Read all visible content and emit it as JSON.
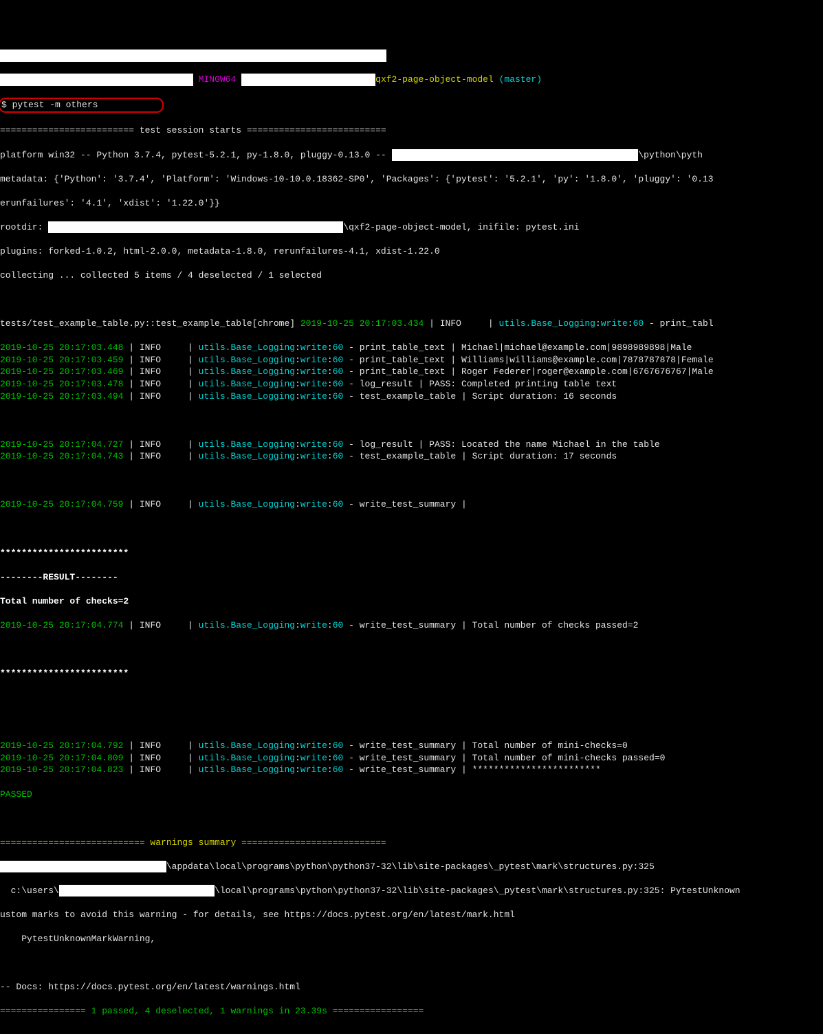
{
  "prompt": {
    "mingw": "MINGW64",
    "repo": "qxf2-page-object-model",
    "branch": "(master)",
    "cmd": "$ pytest -m others"
  },
  "session": {
    "header": "========================= test session starts ==========================",
    "platform": "platform win32 -- Python 3.7.4, pytest-5.2.1, py-1.8.0, pluggy-0.13.0 -- ",
    "platform_tail": "\\python\\pyth",
    "metadata": "metadata: {'Python': '3.7.4', 'Platform': 'Windows-10-10.0.18362-SP0', 'Packages': {'pytest': '5.2.1', 'py': '1.8.0', 'pluggy': '0.13",
    "rerun": "erunfailures': '4.1', 'xdist': '1.22.0'}}",
    "rootdir": "rootdir: ",
    "rootdir_tail": "\\qxf2-page-object-model, inifile: pytest.ini",
    "plugins": "plugins: forked-1.0.2, html-2.0.0, metadata-1.8.0, rerunfailures-4.1, xdist-1.22.0",
    "collecting": "collecting ... collected 5 items / 4 deselected / 1 selected"
  },
  "test": {
    "header": "tests/test_example_table.py::test_example_table[chrome] ",
    "first_ts": "2019-10-25 20:17:03.434",
    "first_info": " | INFO     | ",
    "first_logger": "utils.Base_Logging",
    "first_write": ":write:",
    "first_60": "60",
    "first_tail": " - print_tabl"
  },
  "logs": [
    {
      "ts": "2019-10-25 20:17:03.448",
      "lvl": "INFO",
      "logger": "utils.Base_Logging",
      "fn": "write",
      "ln": "60",
      "msg": "print_table_text | Michael|michael@example.com|9898989898|Male"
    },
    {
      "ts": "2019-10-25 20:17:03.459",
      "lvl": "INFO",
      "logger": "utils.Base_Logging",
      "fn": "write",
      "ln": "60",
      "msg": "print_table_text | Williams|williams@example.com|7878787878|Female"
    },
    {
      "ts": "2019-10-25 20:17:03.469",
      "lvl": "INFO",
      "logger": "utils.Base_Logging",
      "fn": "write",
      "ln": "60",
      "msg": "print_table_text | Roger Federer|roger@example.com|6767676767|Male"
    },
    {
      "ts": "2019-10-25 20:17:03.478",
      "lvl": "INFO",
      "logger": "utils.Base_Logging",
      "fn": "write",
      "ln": "60",
      "msg": "log_result | PASS: Completed printing table text"
    },
    {
      "ts": "2019-10-25 20:17:03.494",
      "lvl": "INFO",
      "logger": "utils.Base_Logging",
      "fn": "write",
      "ln": "60",
      "msg": "test_example_table | Script duration: 16 seconds"
    }
  ],
  "logs2": [
    {
      "ts": "2019-10-25 20:17:04.727",
      "lvl": "INFO",
      "logger": "utils.Base_Logging",
      "fn": "write",
      "ln": "60",
      "msg": "log_result | PASS: Located the name Michael in the table"
    },
    {
      "ts": "2019-10-25 20:17:04.743",
      "lvl": "INFO",
      "logger": "utils.Base_Logging",
      "fn": "write",
      "ln": "60",
      "msg": "test_example_table | Script duration: 17 seconds"
    }
  ],
  "summary_log": {
    "ts": "2019-10-25 20:17:04.759",
    "lvl": "INFO",
    "logger": "utils.Base_Logging",
    "fn": "write",
    "ln": "60",
    "msg": "write_test_summary |"
  },
  "result": {
    "stars": "************************",
    "header": "--------RESULT--------",
    "total": "Total number of checks=2"
  },
  "logs3": [
    {
      "ts": "2019-10-25 20:17:04.774",
      "lvl": "INFO",
      "logger": "utils.Base_Logging",
      "fn": "write",
      "ln": "60",
      "msg": "write_test_summary | Total number of checks passed=2"
    }
  ],
  "stars2": "************************",
  "logs4": [
    {
      "ts": "2019-10-25 20:17:04.792",
      "lvl": "INFO",
      "logger": "utils.Base_Logging",
      "fn": "write",
      "ln": "60",
      "msg": "write_test_summary | Total number of mini-checks=0"
    },
    {
      "ts": "2019-10-25 20:17:04.809",
      "lvl": "INFO",
      "logger": "utils.Base_Logging",
      "fn": "write",
      "ln": "60",
      "msg": "write_test_summary | Total number of mini-checks passed=0"
    },
    {
      "ts": "2019-10-25 20:17:04.823",
      "lvl": "INFO",
      "logger": "utils.Base_Logging",
      "fn": "write",
      "ln": "60",
      "msg": "write_test_summary | ************************"
    }
  ],
  "passed": "PASSED",
  "warnings": {
    "header": "=========================== warnings summary ===========================",
    "line1_tail": "\\appdata\\local\\programs\\python\\python37-32\\lib\\site-packages\\_pytest\\mark\\structures.py:325",
    "line2_pre": "  c:\\users\\",
    "line2_tail": "\\local\\programs\\python\\python37-32\\lib\\site-packages\\_pytest\\mark\\structures.py:325: PytestUnknown",
    "line3": "ustom marks to avoid this warning - for details, see https://docs.pytest.org/en/latest/mark.html",
    "line4": "    PytestUnknownMarkWarning,",
    "docs": "-- Docs: https://docs.pytest.org/en/latest/warnings.html",
    "footer": "================ 1 passed, 4 deselected, 1 warnings in 23.39s ================="
  }
}
